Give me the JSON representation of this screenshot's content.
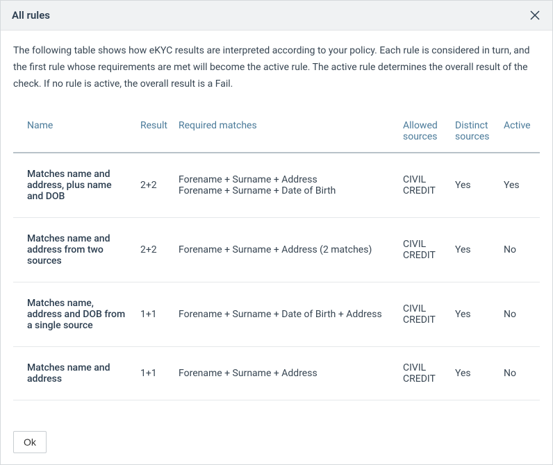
{
  "modal": {
    "title": "All rules",
    "description": "The following table shows how eKYC results are interpreted according to your policy. Each rule is considered in turn, and the first rule whose requirements are met will become the active rule. The active rule determines the overall result of the check. If no rule is active, the overall result is a Fail.",
    "ok_label": "Ok"
  },
  "table": {
    "headers": {
      "name": "Name",
      "result": "Result",
      "matches": "Required matches",
      "allowed": "Allowed sources",
      "distinct": "Distinct sources",
      "active": "Active"
    },
    "rows": [
      {
        "name": "Matches name and address, plus name and DOB",
        "result": "2+2",
        "matches": [
          "Forename + Surname + Address",
          "Forename + Surname + Date of Birth"
        ],
        "allowed": [
          "CIVIL",
          "CREDIT"
        ],
        "distinct": "Yes",
        "active": "Yes"
      },
      {
        "name": "Matches name and address from two sources",
        "result": "2+2",
        "matches": [
          "Forename + Surname + Address (2 matches)"
        ],
        "allowed": [
          "CIVIL",
          "CREDIT"
        ],
        "distinct": "Yes",
        "active": "No"
      },
      {
        "name": "Matches name, address and DOB from a single source",
        "result": "1+1",
        "matches": [
          "Forename + Surname + Date of Birth + Address"
        ],
        "allowed": [
          "CIVIL",
          "CREDIT"
        ],
        "distinct": "Yes",
        "active": "No"
      },
      {
        "name": "Matches name and address",
        "result": "1+1",
        "matches": [
          "Forename + Surname + Address"
        ],
        "allowed": [
          "CIVIL",
          "CREDIT"
        ],
        "distinct": "Yes",
        "active": "No"
      }
    ]
  }
}
